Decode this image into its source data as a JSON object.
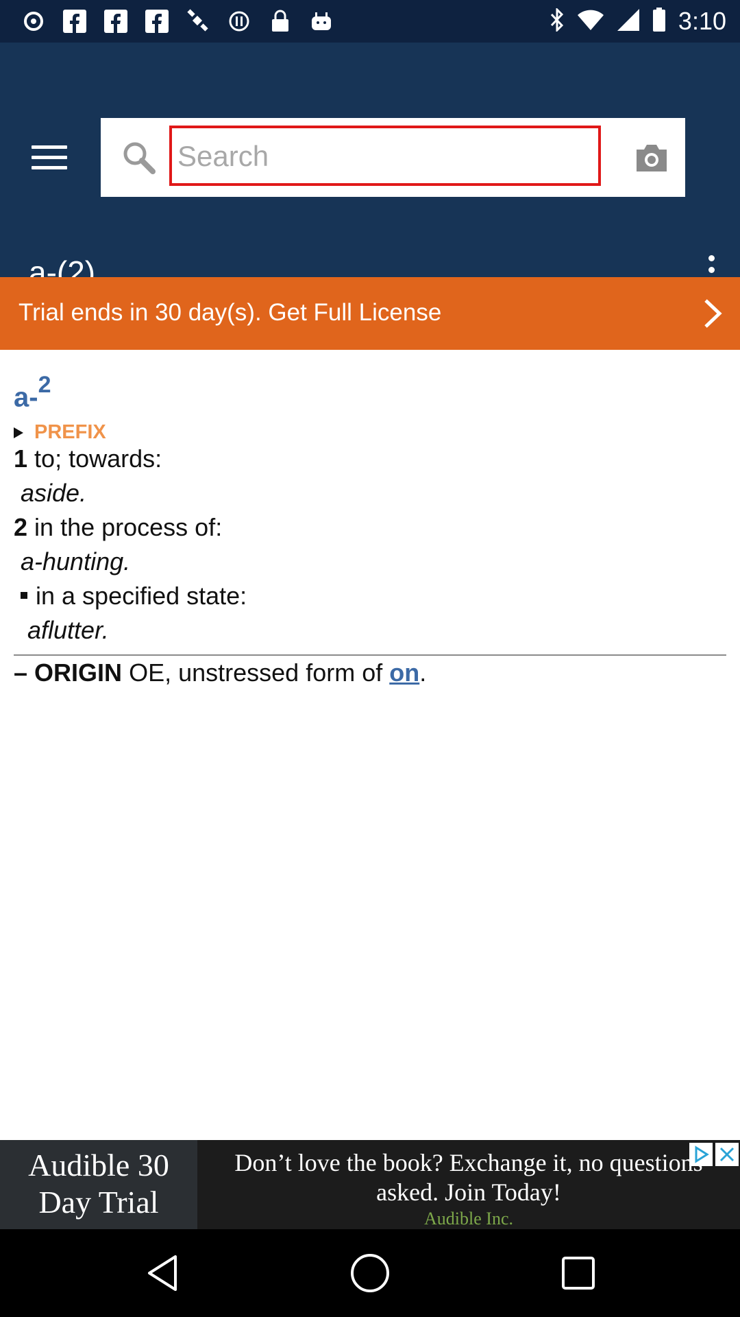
{
  "status_bar": {
    "time": "3:10",
    "left_icons": [
      "media-icon",
      "facebook-icon",
      "facebook-icon",
      "facebook-icon",
      "satellite-icon",
      "sync-icon",
      "lock-icon",
      "android-icon"
    ],
    "right_icons": [
      "bluetooth-icon",
      "wifi-icon",
      "signal-icon",
      "battery-icon"
    ]
  },
  "app_bar": {
    "search": {
      "placeholder": "Search",
      "value": ""
    },
    "entry_title": "a-(2)"
  },
  "trial_banner": {
    "text": "Trial ends in 30 day(s). Get Full License"
  },
  "entry": {
    "headword": "a-",
    "homograph": "2",
    "part_of_speech": "PREFIX",
    "senses": [
      {
        "number": "1",
        "text": "to; towards:",
        "example": "aside."
      },
      {
        "number": "2",
        "text": "in the process of:",
        "example": "a-hunting."
      }
    ],
    "subsense": {
      "text": "in a specified state:",
      "example": "aflutter."
    },
    "origin": {
      "dash": "–",
      "label": "ORIGIN",
      "text": "OE, unstressed form of",
      "link": "on",
      "end": "."
    }
  },
  "ad": {
    "left_text": "Audible 30 Day Trial",
    "body": "Don’t love the book? Exchange it, no questions asked. Join Today!",
    "source": "Audible Inc."
  },
  "colors": {
    "status_bar": "#0e2240",
    "app_bar": "#173456",
    "banner": "#e0651c",
    "headword": "#3c6aa6",
    "part_of_speech": "#f0934a",
    "search_focus_border": "#e01818"
  }
}
